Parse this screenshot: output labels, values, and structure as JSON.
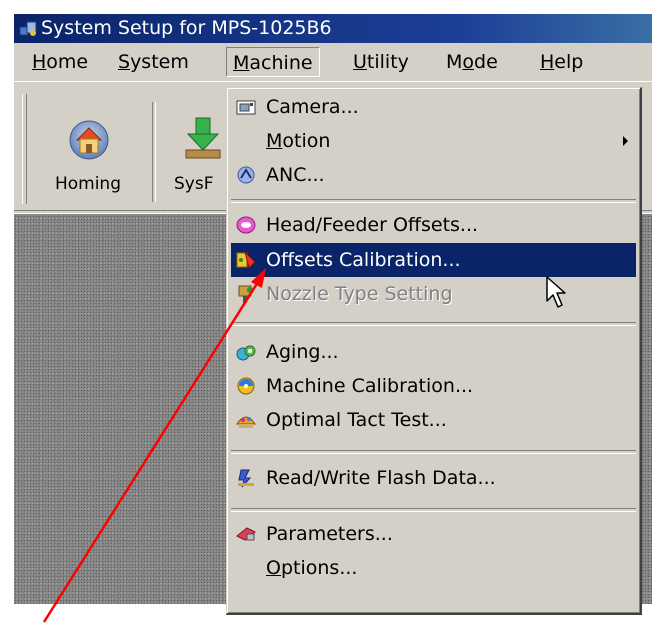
{
  "window": {
    "title": "System Setup for MPS-1025B6"
  },
  "menubar": {
    "items": [
      {
        "label": "Home",
        "underline": "H",
        "rest": "ome"
      },
      {
        "label": "System",
        "underline": "S",
        "rest": "ystem"
      },
      {
        "label": "Machine",
        "underline": "M",
        "rest": "achine"
      },
      {
        "label": "Utility",
        "underline": "U",
        "rest": "tility"
      },
      {
        "label": "Mode",
        "pre": "M",
        "underline": "o",
        "rest": "de"
      },
      {
        "label": "Help",
        "underline": "H",
        "rest": "elp"
      }
    ]
  },
  "toolbar": {
    "buttons": [
      {
        "label": "Homing",
        "icon": "house-icon"
      },
      {
        "label": "SysF",
        "icon": "download-arrow-icon"
      }
    ]
  },
  "dropdown": {
    "items": [
      {
        "label": "Camera...",
        "icon": "camera-icon"
      },
      {
        "label": "Motion",
        "underline": "M",
        "rest": "otion",
        "submenu": true
      },
      {
        "label": "ANC...",
        "icon": "anc-icon"
      },
      {
        "label": "Head/Feeder Offsets...",
        "icon": "offsets-icon"
      },
      {
        "label": "Offsets Calibration...",
        "icon": "calibration-icon",
        "highlighted": true
      },
      {
        "label": "Nozzle Type Setting",
        "icon": "nozzle-icon",
        "disabled": true
      },
      {
        "label": "Aging...",
        "icon": "aging-icon"
      },
      {
        "label": "Machine Calibration...",
        "icon": "machine-calibration-icon"
      },
      {
        "label": "Optimal Tact Test...",
        "icon": "tact-test-icon"
      },
      {
        "label": "Read/Write Flash Data...",
        "icon": "flash-data-icon"
      },
      {
        "label": "Parameters...",
        "icon": "parameters-icon"
      },
      {
        "label": "Options...",
        "underline": "O",
        "rest": "ptions..."
      }
    ]
  },
  "colors": {
    "highlight": "#0a246a",
    "annotation_arrow": "#ff0000",
    "menu_face": "#d4d0c8"
  }
}
